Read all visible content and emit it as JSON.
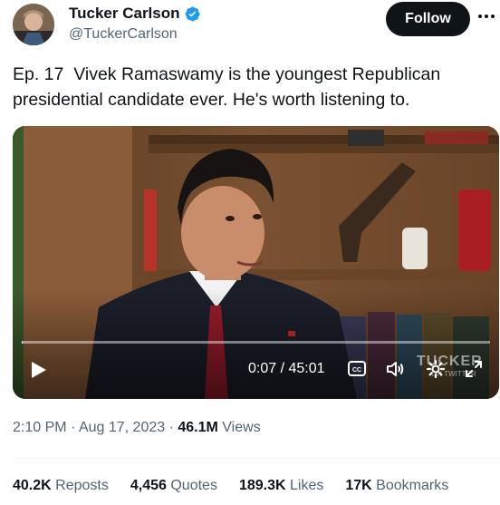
{
  "author": {
    "name": "Tucker Carlson",
    "handle": "@TuckerCarlson",
    "verified_color": "#1d9bf0"
  },
  "actions": {
    "follow_label": "Follow",
    "more_icon": "more-horizontal-icon"
  },
  "tweet": {
    "text": "Ep. 17  Vivek Ramaswamy is the youngest Republican presidential candidate ever. He's worth listening to."
  },
  "video": {
    "timecode": "0:07 / 45:01",
    "progress_fraction": 0.0026,
    "watermark": "TUCKER",
    "watermark_sub": "ON TWITTER",
    "icons": [
      "play-icon",
      "closed-captions-icon",
      "volume-icon",
      "settings-gear-icon",
      "fullscreen-icon"
    ]
  },
  "meta": {
    "time": "2:10 PM",
    "separator": "·",
    "date": "Aug 17, 2023",
    "views_count": "46.1M",
    "views_label": "Views"
  },
  "stats": {
    "reposts_count": "40.2K",
    "reposts_label": "Reposts",
    "quotes_count": "4,456",
    "quotes_label": "Quotes",
    "likes_count": "189.3K",
    "likes_label": "Likes",
    "bookmarks_count": "17K",
    "bookmarks_label": "Bookmarks"
  },
  "colors": {
    "text": "#0f1419",
    "secondary": "#536471",
    "follow_bg": "#0f1419"
  }
}
